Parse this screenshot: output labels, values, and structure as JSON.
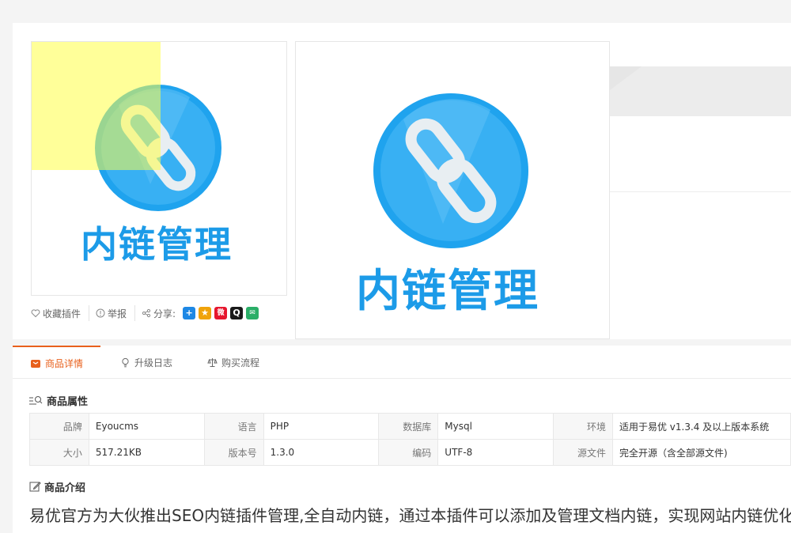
{
  "thumb": {
    "logo_text": "内链管理"
  },
  "main_image": {
    "logo_text": "内链管理"
  },
  "actions": {
    "favorite": "收藏插件",
    "report": "举报",
    "share": "分享:"
  },
  "share_icons": [
    {
      "name": "qzone-icon",
      "glyph": "+",
      "color": "#1e88e5"
    },
    {
      "name": "qq-space-icon",
      "glyph": "★",
      "color": "#f0a30a"
    },
    {
      "name": "weibo-icon",
      "glyph": "微",
      "color": "#e6162d"
    },
    {
      "name": "qq-icon",
      "glyph": "Q",
      "color": "#1a1a1a"
    },
    {
      "name": "wechat-icon",
      "glyph": "✉",
      "color": "#2aae67"
    }
  ],
  "tabs": [
    {
      "label": "商品详情",
      "icon": "bag-icon"
    },
    {
      "label": "升级日志",
      "icon": "bulb-icon"
    },
    {
      "label": "购买流程",
      "icon": "scale-icon"
    }
  ],
  "attributes": {
    "title": "商品属性",
    "rows": [
      [
        {
          "key": "品牌",
          "value": "Eyoucms"
        },
        {
          "key": "语言",
          "value": "PHP"
        },
        {
          "key": "数据库",
          "value": "Mysql"
        },
        {
          "key": "环境",
          "value": "适用于易优 v1.3.4 及以上版本系统"
        }
      ],
      [
        {
          "key": "大小",
          "value": "517.21KB"
        },
        {
          "key": "版本号",
          "value": "1.3.0"
        },
        {
          "key": "编码",
          "value": "UTF-8"
        },
        {
          "key": "源文件",
          "value": "完全开源（含全部源文件)"
        }
      ]
    ]
  },
  "intro": {
    "title": "商品介绍",
    "text": "易优官方为大伙推出SEO内链插件管理,全自动内链，通过本插件可以添加及管理文档内链，实现网站内链优化"
  },
  "colors": {
    "accent": "#e8601c",
    "logo_blue": "#1c9be8",
    "logo_circle": "#29a6ef",
    "highlight": "#ffff66"
  }
}
